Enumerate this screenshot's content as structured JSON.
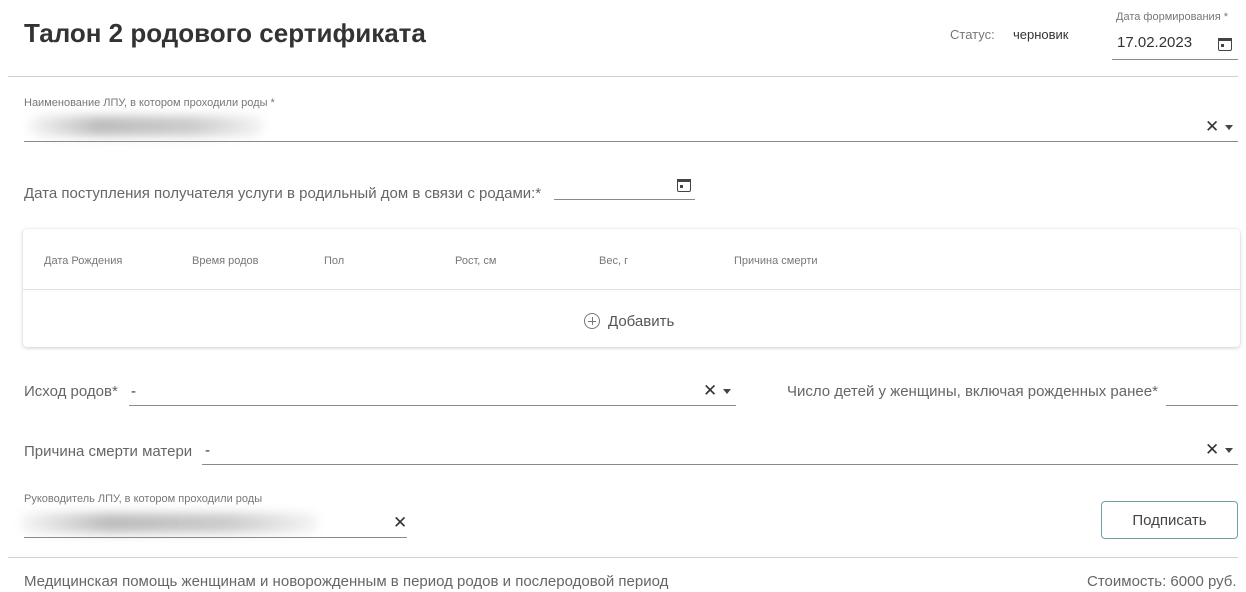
{
  "header": {
    "title": "Талон 2 родового сертификата",
    "status_label": "Статус:",
    "status_value": "черновик",
    "date_label": "Дата формирования *",
    "date_value": "17.02.2023"
  },
  "lpu": {
    "label": "Наименование ЛПУ, в котором проходили роды *",
    "value": ""
  },
  "admission": {
    "label": "Дата поступления получателя услуги в родильный дом в связи с родами:*",
    "value": ""
  },
  "table": {
    "columns": [
      "Дата Рождения",
      "Время родов",
      "Пол",
      "Рост, см",
      "Вес, г",
      "Причина смерти"
    ],
    "rows": [],
    "add_label": "Добавить"
  },
  "outcome": {
    "label": "Исход родов*",
    "value": "-"
  },
  "children_count": {
    "label": "Число детей у женщины, включая рожденных ранее*",
    "value": ""
  },
  "mother_death": {
    "label": "Причина смерти матери",
    "value": "-"
  },
  "head": {
    "label": "Руководитель ЛПУ, в котором проходили роды",
    "value": ""
  },
  "actions": {
    "sign_label": "Подписать"
  },
  "footer": {
    "service": "Медицинская помощь женщинам и новорожденным в период родов и послеродовой период",
    "cost": "Стоимость: 6000 руб."
  },
  "icons": {
    "calendar": "calendar-icon",
    "clear": "close-icon",
    "dropdown": "chevron-down-icon",
    "add": "plus-circle-icon"
  },
  "colors": {
    "accent_border": "#6fa1a4",
    "text_dark": "#333333",
    "text_muted": "#777777"
  }
}
